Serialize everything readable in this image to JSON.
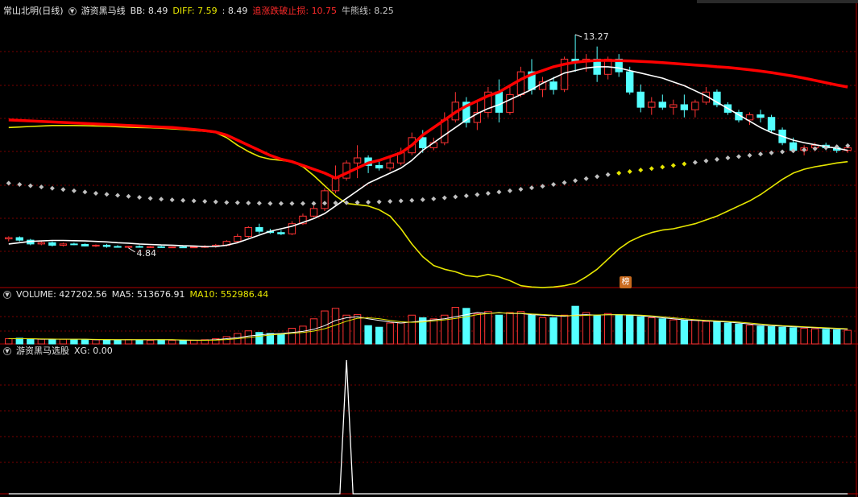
{
  "main_panel": {
    "stock_name": "常山北明(日线)",
    "indicator_name": "游资黑马线",
    "bb_label": "BB:",
    "bb_value": "8.49",
    "diff_label": "DIFF:",
    "diff_value": "7.59",
    "extra_value": ": 8.49",
    "stop_label": "追涨跌破止损:",
    "stop_value": "10.75",
    "bull_label": "牛熊线:",
    "bull_value": "8.25",
    "high_label": "13.27",
    "low_label": "4.84",
    "badge": "榜"
  },
  "volume_panel": {
    "volume_label": "VOLUME:",
    "volume_value": "427202.56",
    "ma5_label": "MA5:",
    "ma5_value": "513676.91",
    "ma10_label": "MA10:",
    "ma10_value": "552986.44"
  },
  "signal_panel": {
    "name": "游资黑马选股",
    "xg_label": "XG:",
    "xg_value": "0.00"
  },
  "colors": {
    "up": "#ff3333",
    "down": "#54ffff",
    "red_line": "#ff0000",
    "yellow_line": "#e6e600",
    "white_line": "#ffffff",
    "dots": "#c0c0c0",
    "grid": "#7a0000"
  },
  "chart_data": {
    "type": "candlestick",
    "bars": 78,
    "price_ylim": [
      3.5,
      14.0
    ],
    "candles_ohlc": [
      [
        5.2,
        5.3,
        5.1,
        5.25
      ],
      [
        5.25,
        5.3,
        5.1,
        5.15
      ],
      [
        5.15,
        5.2,
        4.95,
        5.0
      ],
      [
        5.0,
        5.1,
        4.95,
        5.05
      ],
      [
        5.05,
        5.1,
        4.9,
        4.95
      ],
      [
        4.95,
        5.05,
        4.9,
        5.0
      ],
      [
        5.0,
        5.05,
        4.95,
        4.98
      ],
      [
        4.98,
        5.02,
        4.9,
        4.92
      ],
      [
        4.92,
        4.98,
        4.88,
        4.95
      ],
      [
        4.95,
        5.0,
        4.85,
        4.9
      ],
      [
        4.9,
        4.95,
        4.86,
        4.88
      ],
      [
        4.88,
        4.92,
        4.84,
        4.9
      ],
      [
        4.9,
        4.95,
        4.85,
        4.87
      ],
      [
        4.87,
        4.92,
        4.84,
        4.89
      ],
      [
        4.89,
        4.93,
        4.85,
        4.86
      ],
      [
        4.86,
        4.9,
        4.84,
        4.88
      ],
      [
        4.88,
        4.92,
        4.84,
        4.86
      ],
      [
        4.86,
        4.9,
        4.84,
        4.88
      ],
      [
        4.88,
        4.95,
        4.84,
        4.9
      ],
      [
        4.9,
        5.0,
        4.85,
        4.95
      ],
      [
        4.95,
        5.15,
        4.9,
        5.1
      ],
      [
        5.1,
        5.4,
        5.05,
        5.3
      ],
      [
        5.3,
        5.7,
        5.25,
        5.65
      ],
      [
        5.65,
        5.8,
        5.4,
        5.5
      ],
      [
        5.5,
        5.6,
        5.4,
        5.45
      ],
      [
        5.45,
        5.55,
        5.35,
        5.4
      ],
      [
        5.4,
        5.9,
        5.35,
        5.8
      ],
      [
        5.8,
        6.2,
        5.75,
        6.1
      ],
      [
        6.1,
        6.5,
        6.05,
        6.4
      ],
      [
        6.4,
        7.2,
        6.3,
        7.1
      ],
      [
        7.1,
        8.1,
        7.0,
        7.6
      ],
      [
        7.6,
        8.3,
        7.5,
        8.2
      ],
      [
        8.2,
        8.9,
        7.6,
        8.4
      ],
      [
        8.4,
        8.5,
        7.8,
        8.1
      ],
      [
        8.1,
        8.3,
        7.9,
        8.0
      ],
      [
        8.0,
        8.4,
        7.9,
        8.2
      ],
      [
        8.2,
        8.8,
        8.1,
        8.6
      ],
      [
        8.6,
        9.4,
        8.5,
        9.2
      ],
      [
        9.2,
        9.5,
        8.6,
        8.8
      ],
      [
        8.8,
        9.2,
        8.7,
        9.0
      ],
      [
        9.0,
        10.2,
        8.9,
        9.9
      ],
      [
        9.9,
        11.0,
        9.8,
        10.6
      ],
      [
        10.6,
        10.8,
        9.6,
        9.8
      ],
      [
        9.8,
        10.6,
        9.5,
        10.2
      ],
      [
        10.2,
        11.2,
        10.0,
        11.0
      ],
      [
        11.0,
        11.5,
        9.8,
        10.2
      ],
      [
        10.2,
        11.2,
        10.1,
        10.9
      ],
      [
        10.9,
        12.0,
        10.8,
        11.8
      ],
      [
        11.8,
        12.3,
        10.9,
        11.1
      ],
      [
        11.1,
        11.6,
        10.8,
        11.4
      ],
      [
        11.4,
        11.6,
        10.9,
        11.1
      ],
      [
        11.1,
        12.4,
        11.0,
        12.3
      ],
      [
        12.3,
        13.27,
        11.8,
        12.2
      ],
      [
        12.2,
        12.5,
        11.8,
        12.3
      ],
      [
        12.3,
        12.8,
        11.4,
        11.7
      ],
      [
        11.7,
        12.4,
        11.5,
        12.3
      ],
      [
        12.3,
        12.5,
        11.6,
        11.8
      ],
      [
        11.8,
        12.0,
        10.9,
        11.0
      ],
      [
        11.0,
        11.3,
        10.2,
        10.4
      ],
      [
        10.4,
        10.8,
        10.1,
        10.6
      ],
      [
        10.6,
        10.9,
        10.3,
        10.4
      ],
      [
        10.4,
        10.7,
        10.1,
        10.5
      ],
      [
        10.5,
        10.9,
        10.0,
        10.3
      ],
      [
        10.3,
        10.7,
        10.0,
        10.6
      ],
      [
        10.6,
        11.2,
        10.5,
        11.0
      ],
      [
        11.0,
        11.1,
        10.4,
        10.5
      ],
      [
        10.5,
        10.6,
        10.1,
        10.2
      ],
      [
        10.2,
        10.3,
        9.8,
        9.9
      ],
      [
        9.9,
        10.2,
        9.7,
        10.1
      ],
      [
        10.1,
        10.3,
        9.8,
        10.0
      ],
      [
        10.0,
        10.1,
        9.4,
        9.5
      ],
      [
        9.5,
        9.6,
        8.9,
        9.0
      ],
      [
        9.0,
        9.2,
        8.6,
        8.7
      ],
      [
        8.7,
        8.9,
        8.5,
        8.8
      ],
      [
        8.8,
        9.0,
        8.7,
        8.9
      ],
      [
        8.9,
        9.0,
        8.7,
        8.8
      ],
      [
        8.8,
        8.9,
        8.6,
        8.7
      ],
      [
        8.7,
        8.9,
        8.6,
        8.8
      ]
    ],
    "red_line": [
      9.9,
      9.88,
      9.86,
      9.84,
      9.82,
      9.8,
      9.78,
      9.76,
      9.74,
      9.72,
      9.7,
      9.68,
      9.66,
      9.64,
      9.62,
      9.6,
      9.56,
      9.52,
      9.48,
      9.42,
      9.3,
      9.1,
      8.9,
      8.7,
      8.5,
      8.35,
      8.25,
      8.1,
      7.95,
      7.8,
      7.6,
      7.8,
      8.0,
      8.2,
      8.3,
      8.45,
      8.6,
      8.9,
      9.3,
      9.6,
      9.9,
      10.2,
      10.45,
      10.65,
      10.85,
      11.0,
      11.25,
      11.5,
      11.7,
      11.85,
      12.0,
      12.1,
      12.18,
      12.22,
      12.25,
      12.25,
      12.24,
      12.23,
      12.21,
      12.19,
      12.16,
      12.13,
      12.1,
      12.07,
      12.04,
      12.0,
      11.97,
      11.93,
      11.88,
      11.83,
      11.77,
      11.7,
      11.63,
      11.55,
      11.46,
      11.37,
      11.28,
      11.2
    ],
    "yellow_line": [
      9.6,
      9.62,
      9.64,
      9.66,
      9.68,
      9.68,
      9.68,
      9.67,
      9.66,
      9.65,
      9.63,
      9.61,
      9.6,
      9.59,
      9.57,
      9.55,
      9.52,
      9.48,
      9.45,
      9.4,
      9.2,
      8.9,
      8.65,
      8.45,
      8.35,
      8.3,
      8.25,
      8.05,
      7.7,
      7.3,
      6.9,
      6.6,
      6.55,
      6.5,
      6.35,
      6.1,
      5.6,
      5.0,
      4.5,
      4.15,
      4.0,
      3.9,
      3.75,
      3.7,
      3.8,
      3.7,
      3.55,
      3.35,
      3.3,
      3.28,
      3.3,
      3.35,
      3.45,
      3.7,
      4.0,
      4.4,
      4.8,
      5.1,
      5.3,
      5.45,
      5.55,
      5.6,
      5.7,
      5.8,
      5.95,
      6.1,
      6.3,
      6.5,
      6.7,
      6.95,
      7.25,
      7.55,
      7.8,
      7.95,
      8.05,
      8.12,
      8.2,
      8.25
    ],
    "white_line": [
      5.0,
      5.05,
      5.1,
      5.12,
      5.14,
      5.14,
      5.13,
      5.12,
      5.1,
      5.08,
      5.05,
      5.03,
      5.0,
      4.98,
      4.96,
      4.95,
      4.93,
      4.92,
      4.9,
      4.9,
      4.95,
      5.05,
      5.2,
      5.35,
      5.5,
      5.6,
      5.7,
      5.85,
      6.0,
      6.2,
      6.5,
      6.8,
      7.1,
      7.4,
      7.6,
      7.8,
      8.0,
      8.3,
      8.7,
      9.0,
      9.3,
      9.6,
      9.9,
      10.15,
      10.35,
      10.5,
      10.7,
      10.9,
      11.1,
      11.35,
      11.55,
      11.75,
      11.85,
      11.95,
      12.0,
      12.0,
      11.95,
      11.85,
      11.75,
      11.65,
      11.55,
      11.4,
      11.25,
      11.05,
      10.85,
      10.6,
      10.35,
      10.1,
      9.85,
      9.6,
      9.4,
      9.25,
      9.1,
      9.0,
      8.92,
      8.85,
      8.78,
      8.7
    ],
    "dotted_line": [
      7.4,
      7.35,
      7.3,
      7.25,
      7.2,
      7.15,
      7.1,
      7.05,
      7.0,
      6.96,
      6.92,
      6.88,
      6.84,
      6.8,
      6.77,
      6.74,
      6.72,
      6.7,
      6.68,
      6.66,
      6.64,
      6.63,
      6.62,
      6.61,
      6.6,
      6.6,
      6.6,
      6.6,
      6.6,
      6.61,
      6.62,
      6.63,
      6.64,
      6.65,
      6.66,
      6.68,
      6.7,
      6.72,
      6.75,
      6.78,
      6.82,
      6.86,
      6.9,
      6.95,
      7.0,
      7.05,
      7.1,
      7.16,
      7.22,
      7.28,
      7.35,
      7.42,
      7.5,
      7.58,
      7.66,
      7.74,
      7.8,
      7.86,
      7.92,
      7.98,
      8.04,
      8.1,
      8.16,
      8.22,
      8.28,
      8.34,
      8.4,
      8.45,
      8.5,
      8.55,
      8.6,
      8.64,
      8.68,
      8.72,
      8.76,
      8.8,
      8.84,
      8.88
    ],
    "volume_values": [
      10,
      11,
      10,
      9,
      9,
      9,
      8,
      8,
      8,
      8,
      7,
      8,
      7,
      7,
      8,
      7,
      7,
      7,
      8,
      10,
      14,
      20,
      25,
      22,
      20,
      18,
      30,
      34,
      48,
      63,
      68,
      55,
      56,
      35,
      32,
      40,
      40,
      55,
      50,
      48,
      55,
      70,
      68,
      58,
      62,
      55,
      60,
      62,
      55,
      50,
      50,
      55,
      72,
      60,
      55,
      58,
      56,
      54,
      52,
      50,
      48,
      46,
      45,
      45,
      43,
      42,
      40,
      38,
      36,
      34,
      33,
      32,
      31,
      30,
      29,
      28,
      27,
      26
    ],
    "volume_ma": [
      10,
      10,
      10,
      9,
      9,
      9,
      9,
      9,
      8,
      8,
      8,
      8,
      8,
      8,
      8,
      8,
      7,
      7,
      7,
      8,
      10,
      12,
      15,
      17,
      19,
      20,
      22,
      24,
      28,
      35,
      45,
      50,
      52,
      48,
      45,
      42,
      40,
      42,
      44,
      46,
      48,
      52,
      56,
      60,
      58,
      60,
      58,
      58,
      56,
      55,
      54,
      53,
      55,
      56,
      55,
      56,
      56,
      55,
      54,
      52,
      50,
      48,
      46,
      45,
      44,
      43,
      42,
      40,
      38,
      36,
      35,
      34,
      33,
      32,
      31,
      30,
      29,
      28
    ],
    "volume_ylim": [
      0,
      80
    ],
    "signal_values": [
      0,
      0,
      0,
      0,
      0,
      0,
      0,
      0,
      0,
      0,
      0,
      0,
      0,
      0,
      0,
      0,
      0,
      0,
      0,
      0,
      0,
      0,
      0,
      0,
      0,
      0,
      0,
      0,
      0,
      0,
      0,
      1,
      0,
      0,
      0,
      0,
      0,
      0,
      0,
      0,
      0,
      0,
      0,
      0,
      0,
      0,
      0,
      0,
      0,
      0,
      0,
      0,
      0,
      0,
      0,
      0,
      0,
      0,
      0,
      0,
      0,
      0,
      0,
      0,
      0,
      0,
      0,
      0,
      0,
      0,
      0,
      0,
      0,
      0,
      0,
      0,
      0,
      0
    ]
  }
}
